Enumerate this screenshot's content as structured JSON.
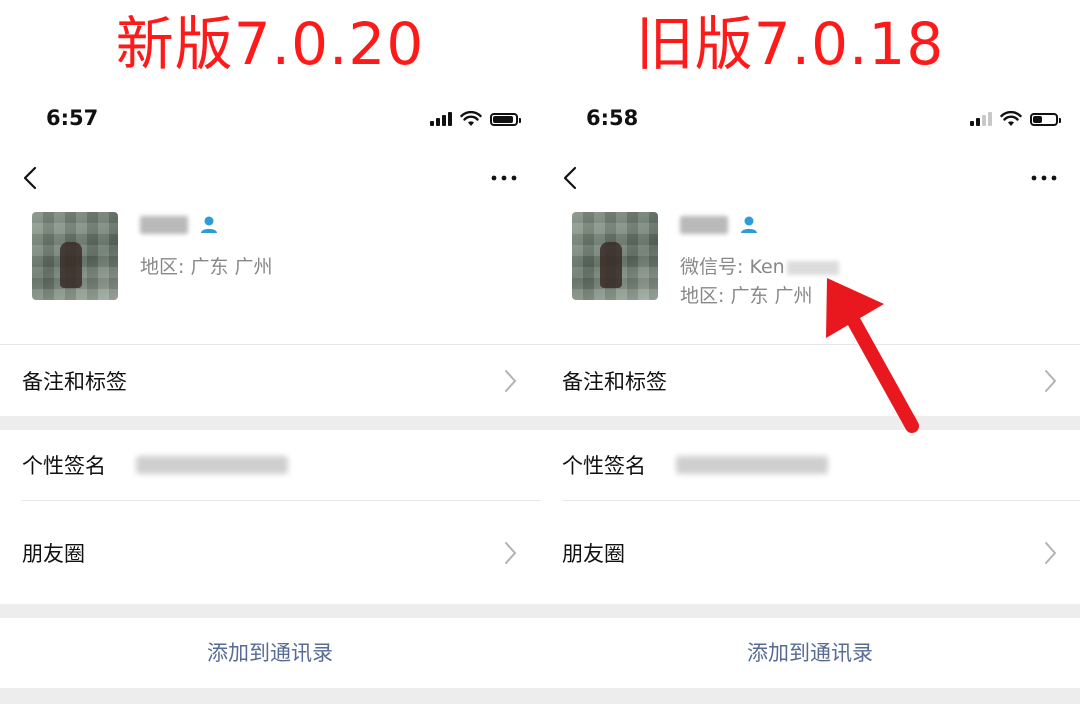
{
  "left_panel": {
    "version_title": "新版7.0.20",
    "time": "6:57",
    "region_text": "地区: 广东 广州",
    "rows": {
      "remark_label": "备注和标签",
      "signature_label": "个性签名",
      "moments_label": "朋友圈"
    },
    "add_contact_label": "添加到通讯录"
  },
  "right_panel": {
    "version_title": "旧版7.0.18",
    "time": "6:58",
    "wechat_id_text": "微信号: Ken",
    "region_text": "地区: 广东 广州",
    "rows": {
      "remark_label": "备注和标签",
      "signature_label": "个性签名",
      "moments_label": "朋友圈"
    },
    "add_contact_label": "添加到通讯录"
  },
  "colors": {
    "title_red": "#ff1a1a",
    "link_blue": "#576b95",
    "contact_icon_blue": "#2d9cdb",
    "arrow_red": "#e8181e"
  },
  "icons": [
    "back-arrow-icon",
    "more-dots-icon",
    "signal-icon",
    "wifi-icon",
    "battery-icon",
    "contact-person-icon",
    "chevron-right-icon"
  ]
}
